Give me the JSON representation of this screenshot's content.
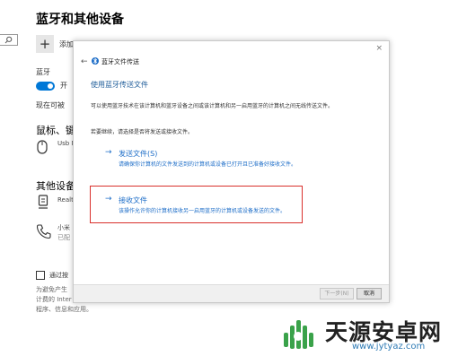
{
  "settings": {
    "title": "蓝牙和其他设备",
    "add_device_label": "添加蓝牙或其他设备",
    "bluetooth_label": "蓝牙",
    "toggle_state": "开",
    "discoverable_text": "现在可被",
    "mouse_section": "鼠标、键",
    "mouse_device": "Usb M",
    "other_section": "其他设备",
    "device1_label": "Realt",
    "device2_name": "小米",
    "device2_sub": "已配",
    "checkbox_label": "通过按",
    "privacy_line1": "为避免产生",
    "privacy_line2": "计费的 Inter",
    "privacy_line3": "程序、信息和应用。"
  },
  "dialog": {
    "close_glyph": "×",
    "back_glyph": "←",
    "titlebar": "蓝牙文件传送",
    "heading": "使用蓝牙传送文件",
    "description": "可以使用蓝牙技术在该计算机和蓝牙设备之间或该计算机和另一启用蓝牙的计算机之间无线传送文件。",
    "prompt": "若要继续，请选择是否将发送或接收文件。",
    "send_option": {
      "arrow": "→",
      "title": "发送文件(S)",
      "desc": "请确保你计算机的文件发送到的计算机或设备已打开且已准备好接收文件。"
    },
    "receive_option": {
      "arrow": "→",
      "title": "接收文件",
      "desc": "该操作允许你的计算机接收另一启用蓝牙的计算机或设备发送的文件。",
      "highlight_color": "#d9302c"
    },
    "next_button": "下一步(N)",
    "cancel_button": "取消"
  },
  "watermark": {
    "brand": "天源安卓网",
    "url": "www.jytyaz.com"
  },
  "colors": {
    "accent": "#0078d7",
    "link": "#1e6ec8"
  }
}
